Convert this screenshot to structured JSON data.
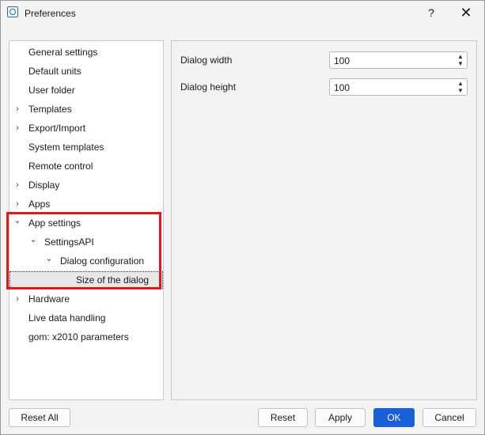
{
  "window": {
    "title": "Preferences",
    "help_label": "?",
    "close_label": "✕"
  },
  "tree": {
    "items": [
      {
        "label": "General settings",
        "expander": ""
      },
      {
        "label": "Default units",
        "expander": ""
      },
      {
        "label": "User folder",
        "expander": ""
      },
      {
        "label": "Templates",
        "expander": "›"
      },
      {
        "label": "Export/Import",
        "expander": "›"
      },
      {
        "label": "System templates",
        "expander": ""
      },
      {
        "label": "Remote control",
        "expander": ""
      },
      {
        "label": "Display",
        "expander": "›"
      },
      {
        "label": "Apps",
        "expander": "›"
      },
      {
        "label": "App settings",
        "expander": "⌄"
      },
      {
        "label": "SettingsAPI",
        "expander": "⌄"
      },
      {
        "label": "Dialog configuration",
        "expander": "⌄"
      },
      {
        "label": "Size of the dialog",
        "expander": ""
      },
      {
        "label": "Hardware",
        "expander": "›"
      },
      {
        "label": "Live data handling",
        "expander": ""
      },
      {
        "label": "gom: x2010 parameters",
        "expander": ""
      }
    ],
    "selected": "Size of the dialog"
  },
  "settings": {
    "dialog_width_label": "Dialog width",
    "dialog_width_value": "100",
    "dialog_height_label": "Dialog height",
    "dialog_height_value": "100"
  },
  "buttons": {
    "reset_all": "Reset All",
    "reset": "Reset",
    "apply": "Apply",
    "ok": "OK",
    "cancel": "Cancel"
  },
  "colors": {
    "accent": "#1a5fd6",
    "highlight_border": "#e01818"
  }
}
